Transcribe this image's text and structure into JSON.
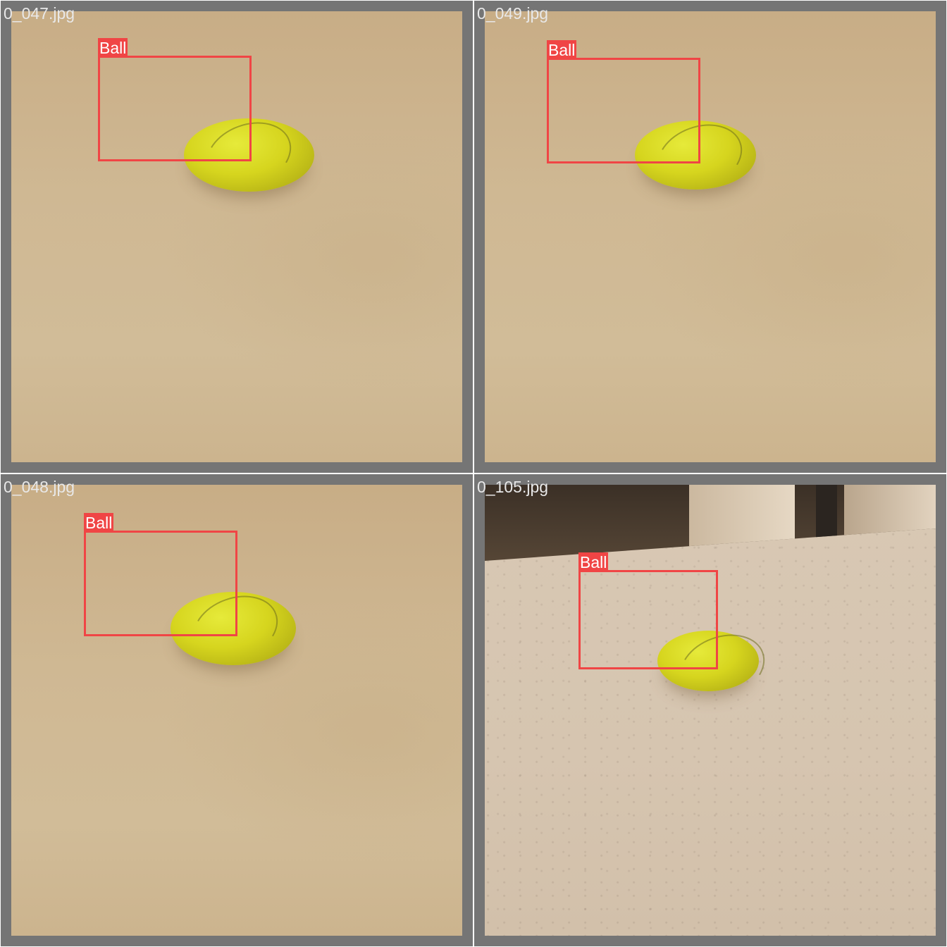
{
  "tiles": [
    {
      "filename": "0_047.jpg",
      "label": "Ball"
    },
    {
      "filename": "0_049.jpg",
      "label": "Ball"
    },
    {
      "filename": "0_048.jpg",
      "label": "Ball"
    },
    {
      "filename": "0_105.jpg",
      "label": "Ball"
    }
  ],
  "colors": {
    "box": "#f04545",
    "frame": "#757575",
    "filename_text": "#e8e8e8"
  }
}
